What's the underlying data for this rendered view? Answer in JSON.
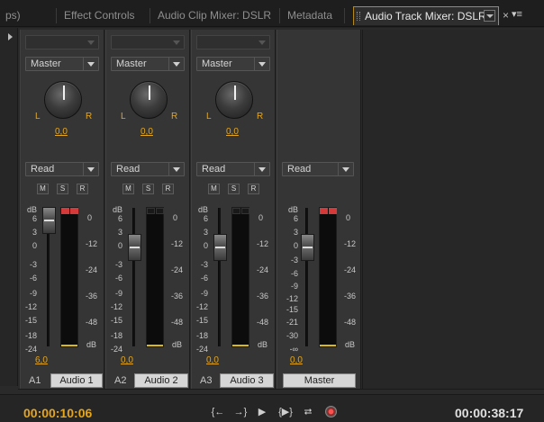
{
  "tabs": [
    {
      "label": "ps)"
    },
    {
      "label": "Effect Controls"
    },
    {
      "label": "Audio Clip Mixer: DSLR"
    },
    {
      "label": "Metadata"
    },
    {
      "label": "Audio Track Mixer: DSLR",
      "active": true
    }
  ],
  "tab_close_glyph": "×",
  "panel_menu_glyph": "▾≡",
  "channels": [
    {
      "id": "A1",
      "output": "Master",
      "pan_left": "L",
      "pan_right": "R",
      "pan_value": "0,0",
      "automation": "Read",
      "mute": "M",
      "solo": "S",
      "record": "R",
      "volume": "6,0",
      "volume_db": 6.0,
      "name": "Audio 1",
      "clip": true
    },
    {
      "id": "A2",
      "output": "Master",
      "pan_left": "L",
      "pan_right": "R",
      "pan_value": "0,0",
      "automation": "Read",
      "mute": "M",
      "solo": "S",
      "record": "R",
      "volume": "0,0",
      "volume_db": 0.0,
      "name": "Audio 2",
      "clip": false
    },
    {
      "id": "A3",
      "output": "Master",
      "pan_left": "L",
      "pan_right": "R",
      "pan_value": "0,0",
      "automation": "Read",
      "mute": "M",
      "solo": "S",
      "record": "R",
      "volume": "0,0",
      "volume_db": 0.0,
      "name": "Audio 3",
      "clip": false
    }
  ],
  "master": {
    "automation": "Read",
    "volume": "0,0",
    "volume_db": 0.0,
    "name": "Master",
    "clip": true
  },
  "fader_scale_label": "dB",
  "fader_scale": [
    "6",
    "3",
    "0",
    "-3",
    "-6",
    "-9",
    "-12",
    "-15",
    "-18",
    "-24",
    "-∞"
  ],
  "master_fader_scale": [
    "6",
    "3",
    "0",
    "-3",
    "-6",
    "-9",
    "-12",
    "-15",
    "-21",
    "-30",
    "-∞"
  ],
  "meter_scale": [
    "0",
    "-12",
    "-24",
    "-36",
    "-48",
    "dB"
  ],
  "transport": {
    "current_time": "00:00:10:06",
    "duration": "00:00:38:17",
    "buttons": {
      "goto_in": "{←",
      "goto_out": "→}",
      "play": "▶",
      "play_in_out": "{▶}",
      "loop": "⮂",
      "record": "record-icon"
    }
  }
}
